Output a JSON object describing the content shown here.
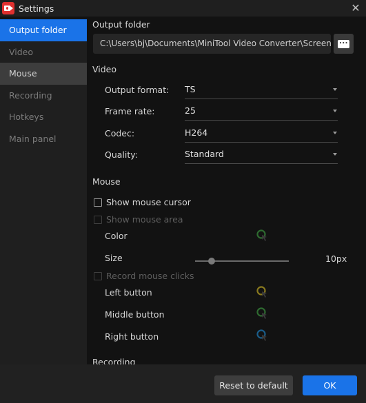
{
  "window": {
    "title": "Settings",
    "app_icon": "video-camera-icon",
    "close_icon": "close-icon"
  },
  "sidebar": {
    "items": [
      {
        "label": "Output folder",
        "state": "active"
      },
      {
        "label": "Video",
        "state": "normal"
      },
      {
        "label": "Mouse",
        "state": "hover"
      },
      {
        "label": "Recording",
        "state": "normal"
      },
      {
        "label": "Hotkeys",
        "state": "normal"
      },
      {
        "label": "Main panel",
        "state": "normal"
      }
    ]
  },
  "output_folder": {
    "heading": "Output folder",
    "path": "C:\\Users\\bj\\Documents\\MiniTool Video Converter\\Screen Record",
    "browse_icon": "more-dots-icon"
  },
  "video": {
    "heading": "Video",
    "fields": [
      {
        "label": "Output format:",
        "value": "TS"
      },
      {
        "label": "Frame rate:",
        "value": "25"
      },
      {
        "label": "Codec:",
        "value": "H264"
      },
      {
        "label": "Quality:",
        "value": "Standard"
      }
    ]
  },
  "mouse": {
    "heading": "Mouse",
    "show_cursor": {
      "label": "Show mouse cursor",
      "checked": false,
      "enabled": true
    },
    "show_area": {
      "label": "Show mouse area",
      "checked": false,
      "enabled": false
    },
    "color_label": "Color",
    "area_color": "#2e7d32",
    "size_label": "Size",
    "size_value": "10px",
    "size_slider_fraction": 0.15,
    "record_clicks": {
      "label": "Record mouse clicks",
      "checked": false,
      "enabled": false
    },
    "clicks": [
      {
        "label": "Left button",
        "color": "#a08a1e"
      },
      {
        "label": "Middle button",
        "color": "#2e6b30"
      },
      {
        "label": "Right button",
        "color": "#1a5d8a"
      }
    ]
  },
  "recording": {
    "heading": "Recording"
  },
  "footer": {
    "reset_label": "Reset to default",
    "ok_label": "OK"
  }
}
